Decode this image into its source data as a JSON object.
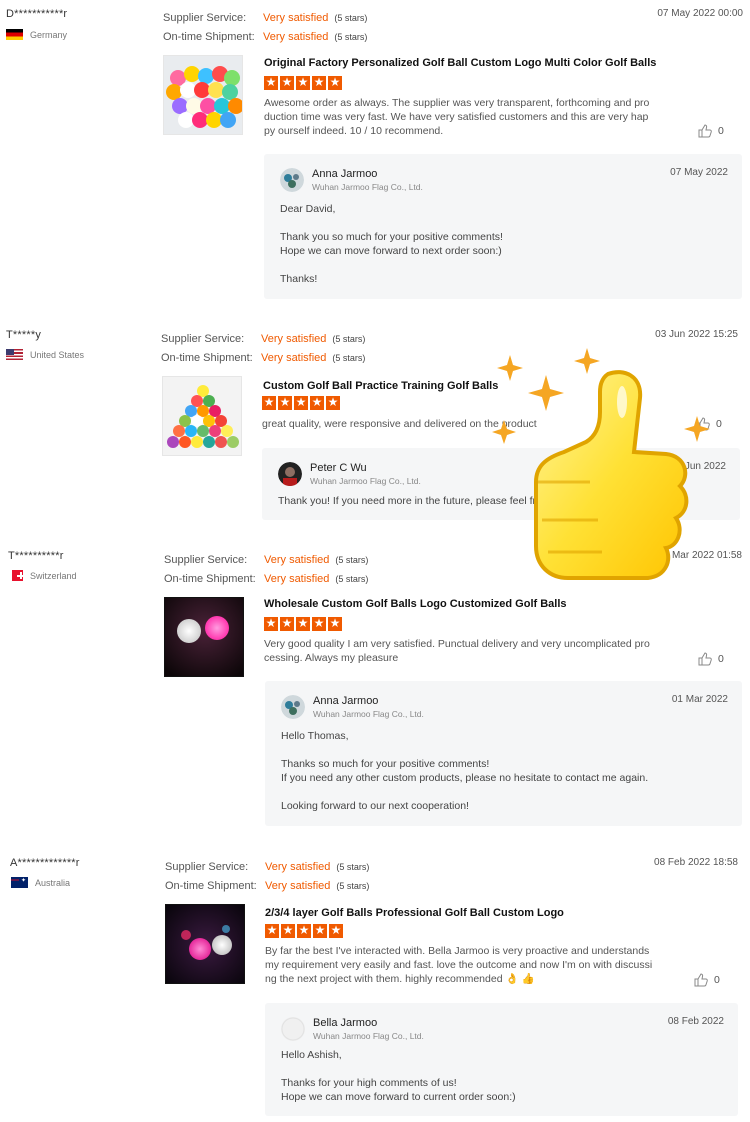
{
  "labels": {
    "supplier_service": "Supplier Service:",
    "ontime_shipment": "On-time Shipment:",
    "very_satisfied": "Very satisfied",
    "five_stars": "(5 stars)"
  },
  "reviews": [
    {
      "buyer": "D***********r",
      "country": "Germany",
      "date": "07 May 2022 00:00",
      "product": "Original Factory Personalized Golf Ball Custom Logo Multi Color Golf Balls",
      "text": "Awesome order as always. The supplier was very transparent, forthcoming and production time was very fast. We have very satisfied customers and this are very happy ourself indeed. 10 / 10 recommend.",
      "likes": "0",
      "reply": {
        "name": "Anna Jarmoo",
        "company": "Wuhan Jarmoo Flag Co., Ltd.",
        "date": "07 May 2022",
        "body": "Dear David,\n\nThank you so much for your positive comments!\nHope we can move forward to next  order soon:)\n\nThanks!"
      }
    },
    {
      "buyer": "T*****y",
      "country": "United States",
      "date": "03 Jun 2022 15:25",
      "product": "Custom Golf Ball Practice Training Golf Balls",
      "text": "great quality, were responsive and delivered on the product",
      "likes": "0",
      "reply": {
        "name": "Peter C Wu",
        "company": "Wuhan Jarmoo Flag Co., Ltd.",
        "date": "05 Jun 2022",
        "body": "Thank you! If you need more in the future, please feel fr"
      }
    },
    {
      "buyer": "T**********r",
      "country": "Switzerland",
      "date": "01 Mar 2022 01:58",
      "product": "Wholesale Custom Golf Balls Logo Customized Golf Balls",
      "text": "Very good quality I am very satisfied. Punctual delivery and very uncomplicated processing. Always my pleasure",
      "likes": "0",
      "reply": {
        "name": "Anna Jarmoo",
        "company": "Wuhan Jarmoo Flag Co., Ltd.",
        "date": "01 Mar 2022",
        "body": "Hello Thomas,\n\nThanks so much for your positive comments!\nIf you need any other custom products, please no hesitate to contact me again.\n\nLooking forward to our next cooperation!"
      }
    },
    {
      "buyer": "A*************r",
      "country": "Australia",
      "date": "08 Feb 2022 18:58",
      "product": "2/3/4 layer Golf Balls Professional Golf Ball Custom Logo",
      "text": "By far the best I've interacted with. Bella Jarmoo is very proactive and understands my requirement very easily and fast. love the outcome and now I'm on with discussing the next project with them. highly recommended 👌 👍",
      "likes": "0",
      "reply": {
        "name": "Bella Jarmoo",
        "company": "Wuhan Jarmoo Flag Co., Ltd.",
        "date": "08 Feb 2022",
        "body": "Hello Ashish,\n\nThanks for your high comments of us!\nHope we can move forward to current order soon:)"
      }
    }
  ],
  "colors": {
    "accent": "#f05a00",
    "reply_bg": "#f5f6f7",
    "thumb": "#ffd83a"
  },
  "icons": [
    "like-icon",
    "thumbs-up-sticker-icon",
    "sparkle-icon"
  ]
}
